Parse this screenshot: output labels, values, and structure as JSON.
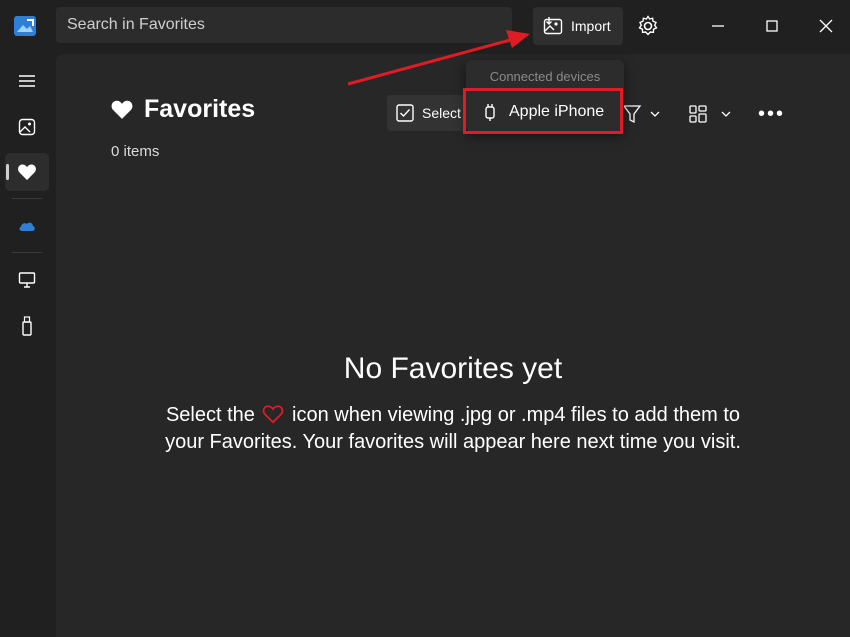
{
  "titlebar": {
    "search_placeholder": "Search in Favorites",
    "import_label": "Import",
    "icons": [
      "photos-app-icon",
      "import-icon",
      "gear-icon",
      "minimize-icon",
      "maximize-icon",
      "close-icon"
    ]
  },
  "sidebar": {
    "items": [
      {
        "name": "hamburger-menu",
        "icon": "hamburger-icon"
      },
      {
        "name": "gallery",
        "icon": "gallery-icon"
      },
      {
        "name": "favorites",
        "icon": "heart-icon",
        "active": true
      },
      {
        "name": "onedrive",
        "icon": "cloud-icon"
      },
      {
        "name": "this-pc",
        "icon": "monitor-icon"
      },
      {
        "name": "usb-device",
        "icon": "usb-icon"
      }
    ]
  },
  "main": {
    "title": "Favorites",
    "items_count": "0 items",
    "select_label": "Select",
    "empty_title": "No Favorites yet",
    "empty_desc_before": "Select the",
    "empty_desc_after_line1": "icon when viewing .jpg or .mp4 files to add them to",
    "empty_desc_line2": "your Favorites. Your favorites will appear here next time you visit."
  },
  "dropdown": {
    "header": "Connected devices",
    "device_label": "Apple iPhone"
  },
  "colors": {
    "background": "#202020",
    "panel": "#272727",
    "annotation_red": "#e01b24",
    "accent_blue": "#2f7fd6"
  }
}
